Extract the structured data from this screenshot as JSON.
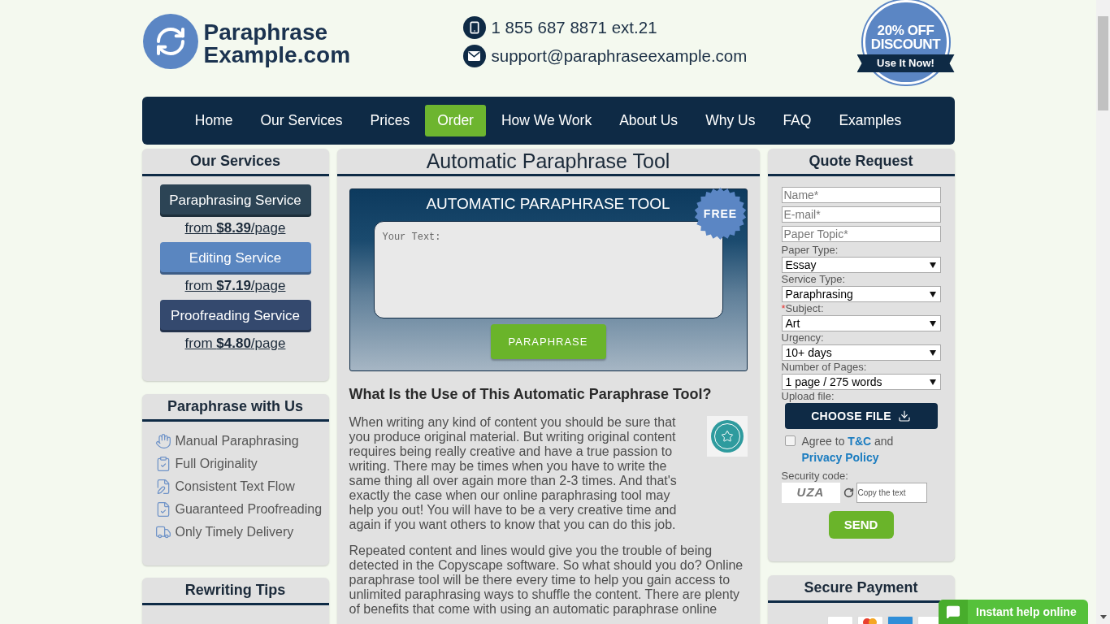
{
  "logo": {
    "lines": [
      "Paraphrase",
      "Example.com"
    ]
  },
  "contacts": [
    {
      "kind": "phone",
      "text": "1 855 687 8871 ext.21"
    },
    {
      "kind": "email",
      "text": "support@paraphraseexample.com"
    }
  ],
  "discount_badge": {
    "lines": [
      "20% OFF",
      "DISCOUNT"
    ],
    "ribbon": "Use It Now!"
  },
  "nav": [
    {
      "label": "Home",
      "selected": false
    },
    {
      "label": "Our Services",
      "selected": false
    },
    {
      "label": "Prices",
      "selected": false
    },
    {
      "label": "Order",
      "selected": true
    },
    {
      "label": "How We Work",
      "selected": false
    },
    {
      "label": "About Us",
      "selected": false
    },
    {
      "label": "Why Us",
      "selected": false
    },
    {
      "label": "FAQ",
      "selected": false
    },
    {
      "label": "Examples",
      "selected": false
    }
  ],
  "our_services": {
    "title": "Our Services",
    "items": [
      {
        "label": "Paraphrasing Service",
        "color": "#2c4455",
        "price": "from **$8.39**/page"
      },
      {
        "label": "Editing Service",
        "color": "#5a86c0",
        "price": "from **$7.19**/page"
      },
      {
        "label": "Proofreading Service",
        "color": "#34496e",
        "price": "from **$4.80**/page"
      }
    ]
  },
  "paraphrase_with_us": {
    "title": "Paraphrase with Us",
    "items": [
      "Manual Paraphrasing",
      "Full Originality",
      "Consistent Text Flow",
      "Guaranteed Proofreading",
      "Only Timely Delivery"
    ]
  },
  "rewriting_tips": {
    "title": "Rewriting Tips"
  },
  "tool": {
    "title": "Automatic Paraphrase Tool",
    "banner": "AUTOMATIC PARAPHRASE TOOL",
    "badge": "FREE",
    "placeholder": "Your Text:",
    "button": "PARAPHRASE"
  },
  "article": {
    "heading": "What Is the Use of This Automatic Paraphrase Tool?",
    "paragraphs": [
      "When writing any kind of content you should be sure that you produce original material. But writing original content requires being really creative and have a true passion to writing. There may be times when you have to write the same thing all over again more than 2-3 times. And that's exactly the case when our online paraphrasing tool may help you out! You will have to be a very creative time and again if you want others to know that you can do this job.",
      "Repeated content and lines would give you the trouble of being detected in the Copyscape software. So what should you do? Online paraphrase tool will be there every time to help you gain access to unlimited paraphrasing ways to shuffle the content. There are plenty of benefits that come with using an automatic paraphrase online"
    ]
  },
  "quote_request": {
    "title": "Quote Request",
    "fields": [
      {
        "kind": "input",
        "placeholder": "Name*"
      },
      {
        "kind": "input",
        "placeholder": "E-mail*"
      },
      {
        "kind": "input",
        "placeholder": "Paper Topic*"
      },
      {
        "kind": "select",
        "label": "Paper Type:",
        "value": "Essay"
      },
      {
        "kind": "select",
        "label": "Service Type:",
        "value": "Paraphrasing"
      },
      {
        "kind": "select",
        "required_mark": "*",
        "label": "Subject:",
        "value": "Art"
      },
      {
        "kind": "select",
        "label": "Urgency:",
        "value": "10+ days"
      },
      {
        "kind": "select",
        "label": "Number of Pages:",
        "value": "1 page / 275 words"
      }
    ],
    "upload": {
      "label": "Upload file:",
      "button": "CHOOSE FILE"
    },
    "agree": {
      "checked": false,
      "parts": [
        {
          "kind": "text",
          "text": "Agree to"
        },
        {
          "kind": "link",
          "text": "T&C"
        },
        {
          "kind": "text",
          "text": "and"
        },
        {
          "kind": "link",
          "text": "Privacy Policy"
        }
      ]
    },
    "security": {
      "label": "Security code:",
      "captcha": "UZA",
      "placeholder": "Copy the text"
    },
    "send": "SEND"
  },
  "secure_payment": {
    "title": "Secure Payment"
  },
  "chat": {
    "label": "Instant help online"
  }
}
